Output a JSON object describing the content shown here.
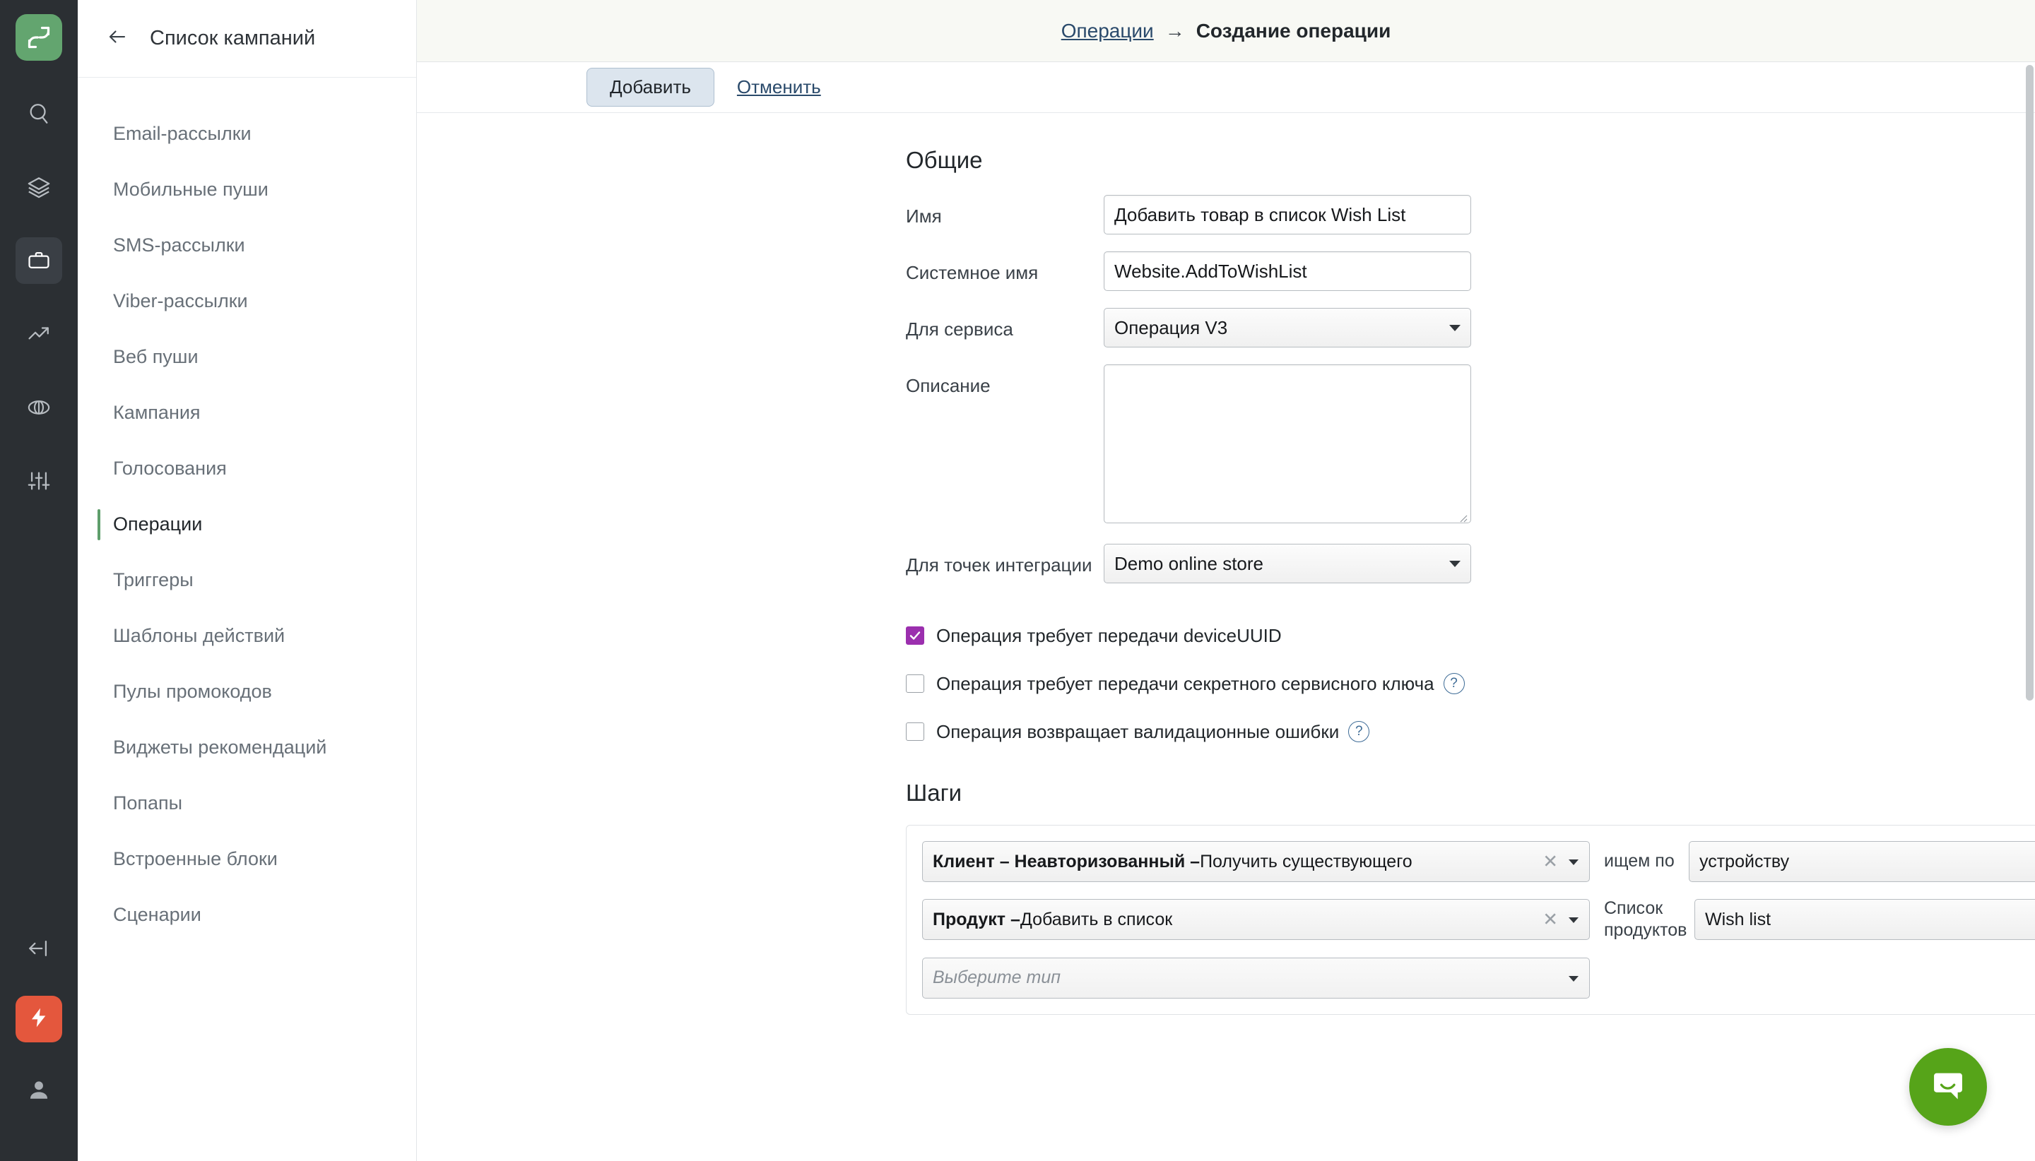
{
  "rail": {
    "logo_icon": "brand-logo-icon",
    "items": [
      {
        "icon": "search-icon",
        "active": false
      },
      {
        "icon": "layers-icon",
        "active": false
      },
      {
        "icon": "briefcase-icon",
        "active": true
      },
      {
        "icon": "trending-up-icon",
        "active": false
      },
      {
        "icon": "globe-icon",
        "active": false
      },
      {
        "icon": "sliders-icon",
        "active": false
      }
    ],
    "bottom": [
      {
        "icon": "collapse-left-icon"
      },
      {
        "icon": "flash-icon"
      },
      {
        "icon": "user-icon"
      }
    ]
  },
  "sidebar": {
    "back_icon": "arrow-left-icon",
    "title": "Список кампаний",
    "items": [
      {
        "label": "Email-рассылки",
        "active": false
      },
      {
        "label": "Мобильные пуши",
        "active": false
      },
      {
        "label": "SMS-рассылки",
        "active": false
      },
      {
        "label": "Viber-рассылки",
        "active": false
      },
      {
        "label": "Веб пуши",
        "active": false
      },
      {
        "label": "Кампания",
        "active": false
      },
      {
        "label": "Голосования",
        "active": false
      },
      {
        "label": "Операции",
        "active": true
      },
      {
        "label": "Триггеры",
        "active": false
      },
      {
        "label": "Шаблоны действий",
        "active": false
      },
      {
        "label": "Пулы промокодов",
        "active": false
      },
      {
        "label": "Виджеты рекомендаций",
        "active": false
      },
      {
        "label": "Попапы",
        "active": false
      },
      {
        "label": "Встроенные блоки",
        "active": false
      },
      {
        "label": "Сценарии",
        "active": false
      }
    ]
  },
  "breadcrumb": {
    "parent": "Операции",
    "separator": "→",
    "current": "Создание операции"
  },
  "actions": {
    "submit_label": "Добавить",
    "cancel_label": "Отменить"
  },
  "general": {
    "heading": "Общие",
    "name_label": "Имя",
    "name_value": "Добавить товар в список Wish List",
    "system_name_label": "Системное имя",
    "system_name_value": "Website.AddToWishList",
    "service_label": "Для сервиса",
    "service_value": "Операция V3",
    "description_label": "Описание",
    "description_value": "",
    "integration_label": "Для точек интеграции",
    "integration_value": "Demo online store"
  },
  "checkboxes": [
    {
      "label": "Операция требует передачи deviceUUID",
      "checked": true,
      "help": false
    },
    {
      "label": "Операция требует передачи секретного сервисного ключа",
      "checked": false,
      "help": true
    },
    {
      "label": "Операция возвращает валидационные ошибки",
      "checked": false,
      "help": true
    }
  ],
  "help_glyph": "?",
  "steps": {
    "heading": "Шаги",
    "rows": [
      {
        "action_strong": "Клиент – Неавторизованный – ",
        "action_rest": "Получить существующего",
        "clear_glyph": "✕",
        "mid_label": "ищем по",
        "value": "устройству",
        "placeholder": false
      },
      {
        "action_strong": "Продукт – ",
        "action_rest": "Добавить в список",
        "clear_glyph": "✕",
        "mid_label": "Список продуктов",
        "value": "Wish list",
        "placeholder": false
      },
      {
        "action_strong": "",
        "action_rest": "Выберите тип",
        "clear_glyph": "",
        "mid_label": "",
        "value": "",
        "placeholder": true
      }
    ]
  },
  "chat": {
    "icon": "chat-bubble-icon",
    "color": "#56a419"
  },
  "colors": {
    "rail_bg": "#2b2f33",
    "brand_green": "#63a56f",
    "accent_purple": "#9b2fae",
    "flash_red": "#e4573d",
    "link_blue": "#2a4a6b"
  }
}
